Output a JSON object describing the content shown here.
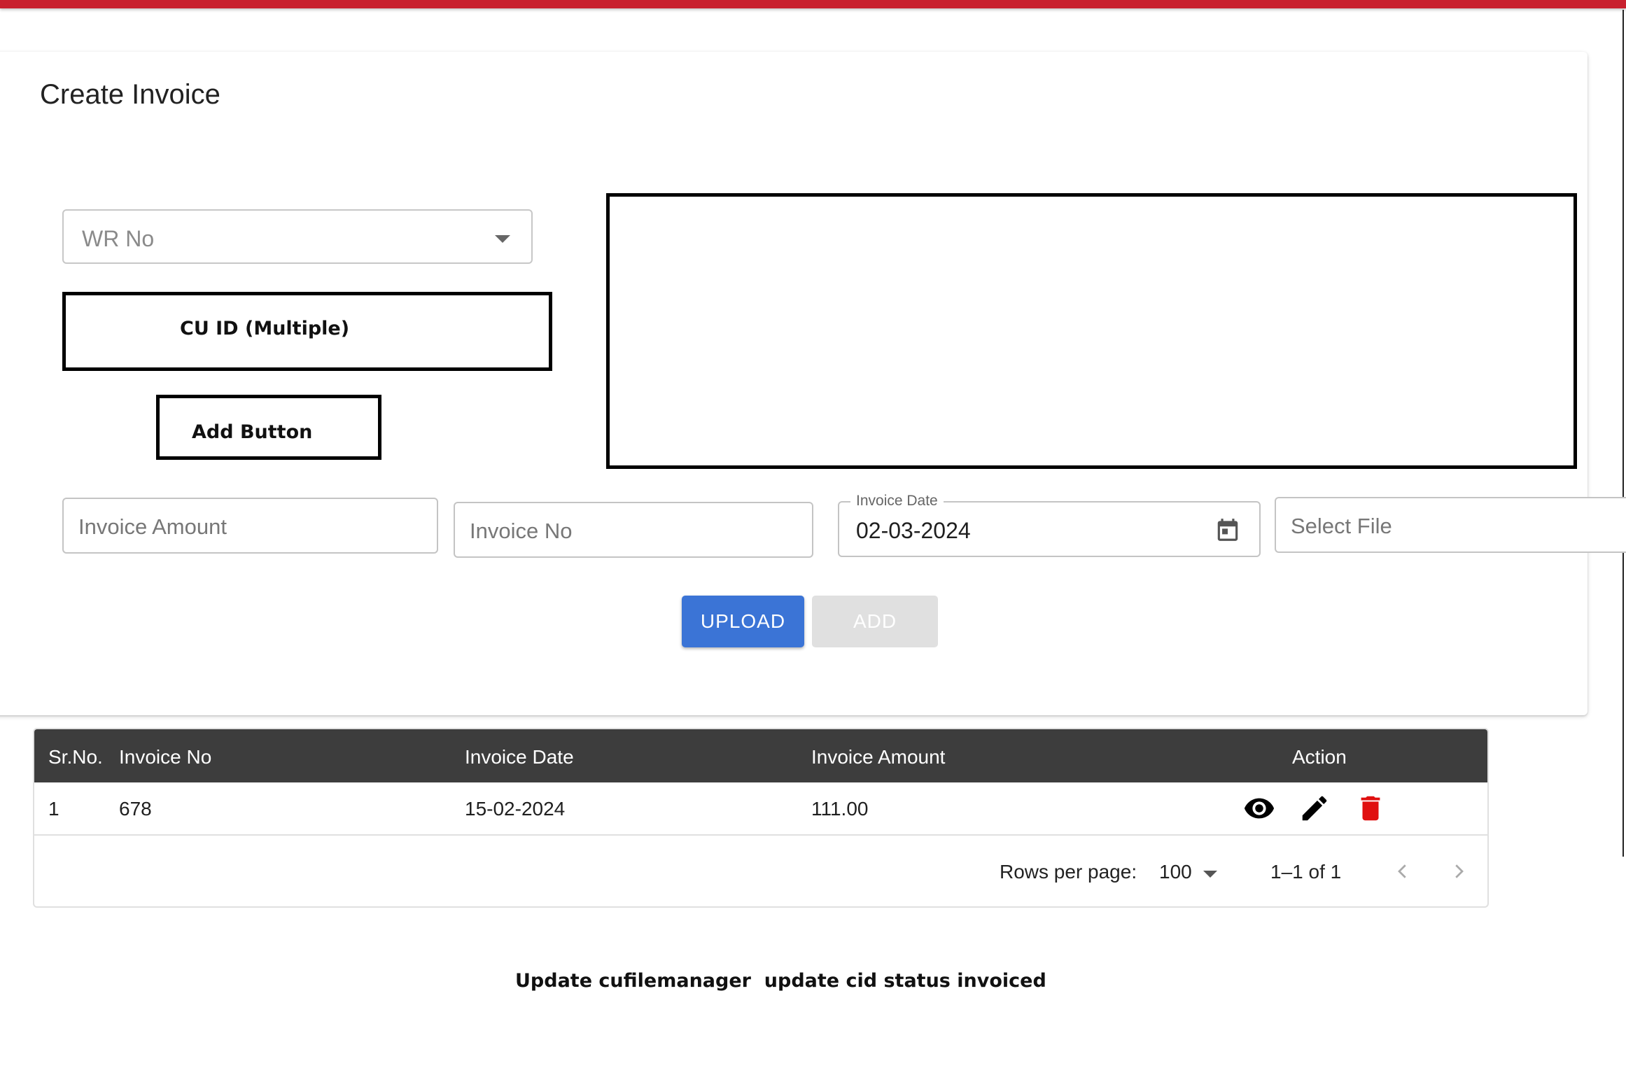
{
  "page": {
    "title": "Create Invoice"
  },
  "form": {
    "wr_no_placeholder": "WR No",
    "cu_id_label": "CU ID (Multiple)",
    "add_button_label": "Add Button",
    "invoice_amount_placeholder": "Invoice Amount",
    "invoice_no_placeholder": "Invoice No",
    "invoice_date_label": "Invoice Date",
    "invoice_date_value": "02-03-2024",
    "select_file_placeholder": "Select File",
    "upload_label": "UPLOAD",
    "add_label": "ADD"
  },
  "table": {
    "headers": [
      "Sr.No.",
      "Invoice No",
      "Invoice Date",
      "Invoice Amount",
      "Action"
    ],
    "rows": [
      {
        "sr": "1",
        "invoice_no": "678",
        "invoice_date": "15-02-2024",
        "invoice_amount": "111.00"
      }
    ],
    "actions": [
      "eye-icon",
      "pencil-icon",
      "trash-icon"
    ],
    "pagination": {
      "rows_per_page_label": "Rows per page:",
      "rows_per_page_value": "100",
      "range": "1–1 of 1"
    }
  },
  "note": "Update cufilemanager  update cid status invoiced",
  "colors": {
    "top_bar": "#c8202e",
    "upload_button": "#3b74d6",
    "delete_icon": "#e01010",
    "table_header": "#3d3d3d"
  }
}
